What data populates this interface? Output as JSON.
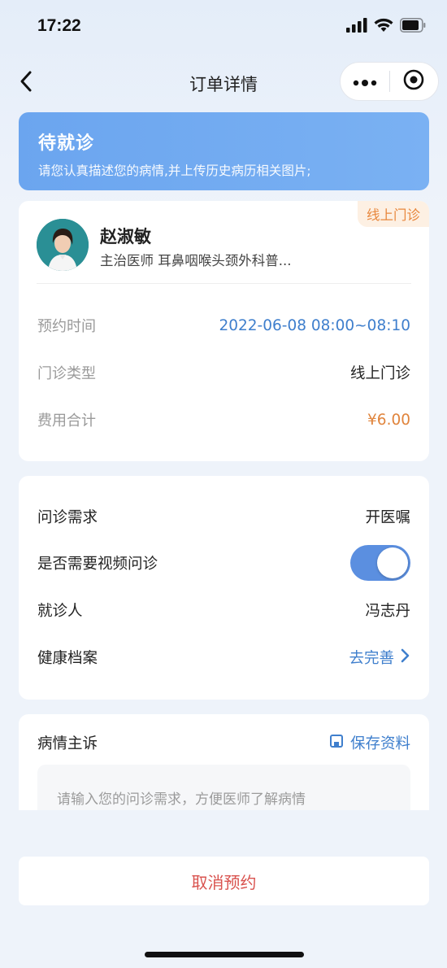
{
  "status_bar": {
    "time": "17:22"
  },
  "nav": {
    "title": "订单详情"
  },
  "banner": {
    "title": "待就诊",
    "description": "请您认真描述您的病情,并上传历史病历相关图片;"
  },
  "doctor": {
    "tag": "线上门诊",
    "name": "赵淑敏",
    "info": "主治医师 耳鼻咽喉头颈外科普..."
  },
  "appointment": {
    "time_label": "预约时间",
    "time_value": "2022-06-08 08:00~08:10",
    "type_label": "门诊类型",
    "type_value": "线上门诊",
    "fee_label": "费用合计",
    "fee_value": "¥6.00"
  },
  "consult": {
    "need_label": "问诊需求",
    "need_value": "开医嘱",
    "video_label": "是否需要视频问诊",
    "video_enabled": true,
    "patient_label": "就诊人",
    "patient_value": "冯志丹",
    "record_label": "健康档案",
    "record_value": "去完善"
  },
  "complaint": {
    "title": "病情主诉",
    "save_label": "保存资料",
    "placeholder": "请输入您的问诊需求，方便医师了解病情"
  },
  "footer": {
    "cancel_label": "取消预约"
  },
  "colors": {
    "accent_blue": "#3f7fcd",
    "banner_blue": "#6ba5ef",
    "orange": "#e0843c",
    "cancel_red": "#d9534f",
    "toggle_blue": "#5b8fe0"
  },
  "icons": [
    "back-arrow-icon",
    "more-dots-icon",
    "record-target-icon",
    "signal-icon",
    "wifi-icon",
    "battery-icon",
    "chevron-right-icon",
    "save-disk-icon"
  ]
}
